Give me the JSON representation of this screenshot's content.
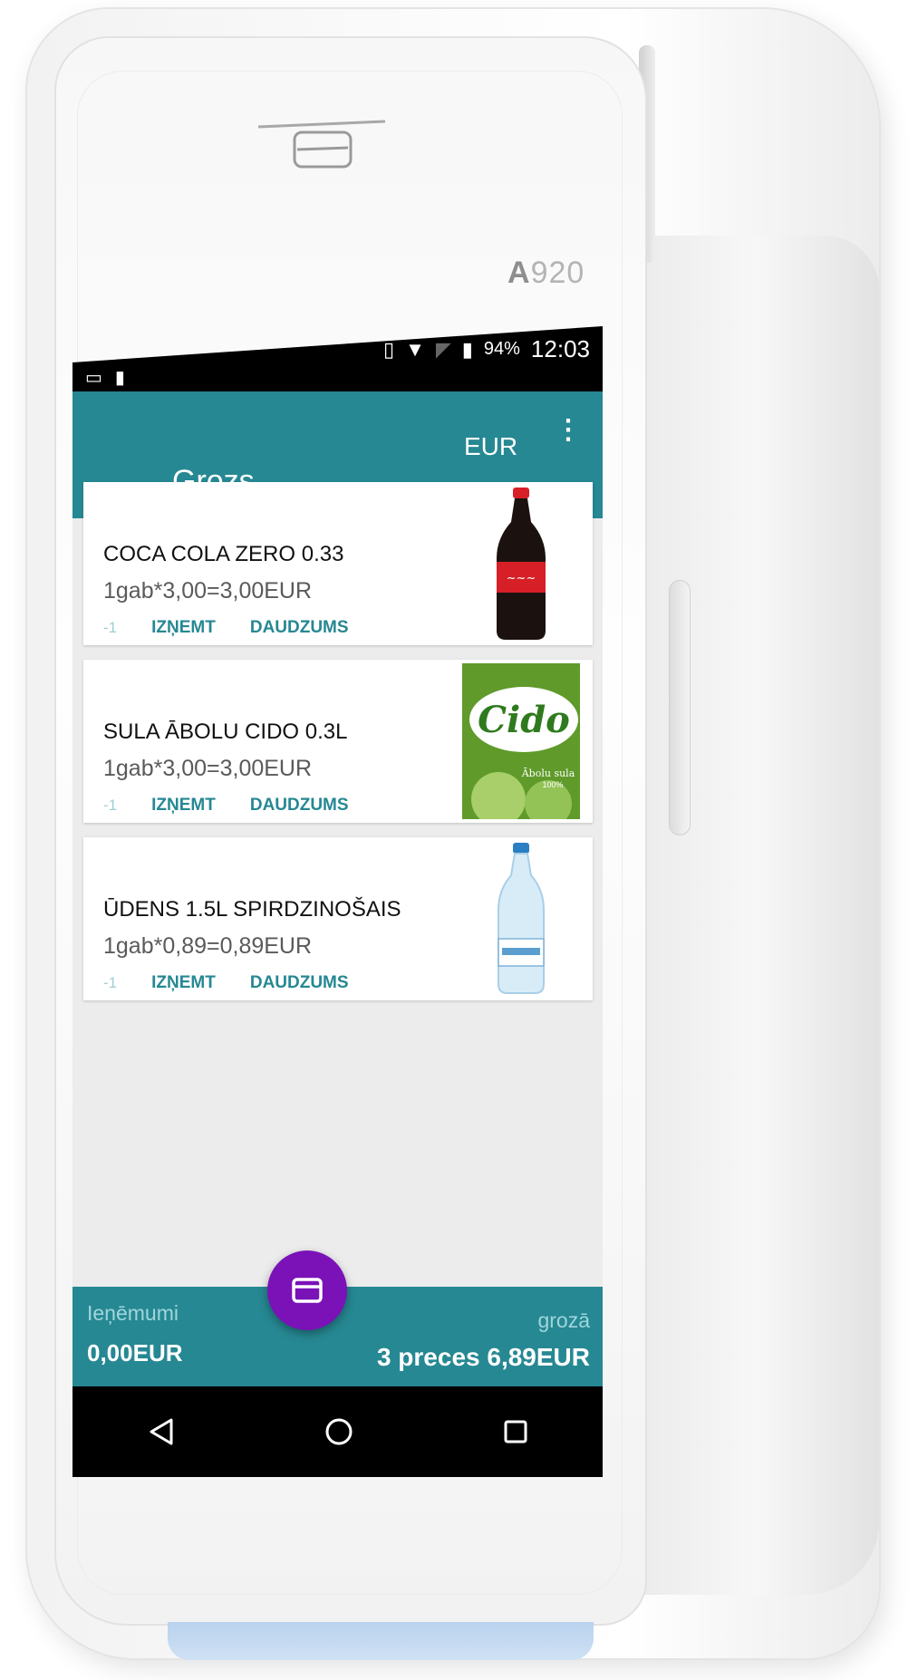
{
  "device": {
    "model_prefix": "A",
    "model_number": "920"
  },
  "status_bar": {
    "battery": "94%",
    "time": "12:03"
  },
  "app_bar": {
    "title": "Grozs",
    "currency": "EUR"
  },
  "items": [
    {
      "name": "COCA COLA ZERO 0.33",
      "price_line": "1gab*3,00=3,00EUR",
      "image": "cola-bottle"
    },
    {
      "name": "SULA ĀBOLU CIDO 0.3L",
      "price_line": "1gab*3,00=3,00EUR",
      "image": "cido-juice-box",
      "brand": "Cido",
      "sub_text": "Ābolu sula",
      "sub_pct": "100%"
    },
    {
      "name": "ŪDENS 1.5L SPIRDZINOŠAIS",
      "price_line": "1gab*0,89=0,89EUR",
      "image": "water-bottle"
    }
  ],
  "actions": {
    "minus": "-1",
    "remove": "IZŅEMT",
    "quantity": "DAUDZUMS"
  },
  "footer": {
    "revenue_label": "Ieņēmumi",
    "revenue_value": "0,00EUR",
    "cart_label": "grozā",
    "cart_summary": "3 preces 6,89EUR"
  },
  "icons": {
    "back": "arrow-left-icon",
    "menu": "more-vert-icon",
    "fab": "payment-card-icon",
    "nav": [
      "back-triangle-icon",
      "home-circle-icon",
      "recents-square-icon"
    ]
  },
  "colors": {
    "primary": "#268893",
    "accent": "#7a12b8"
  }
}
